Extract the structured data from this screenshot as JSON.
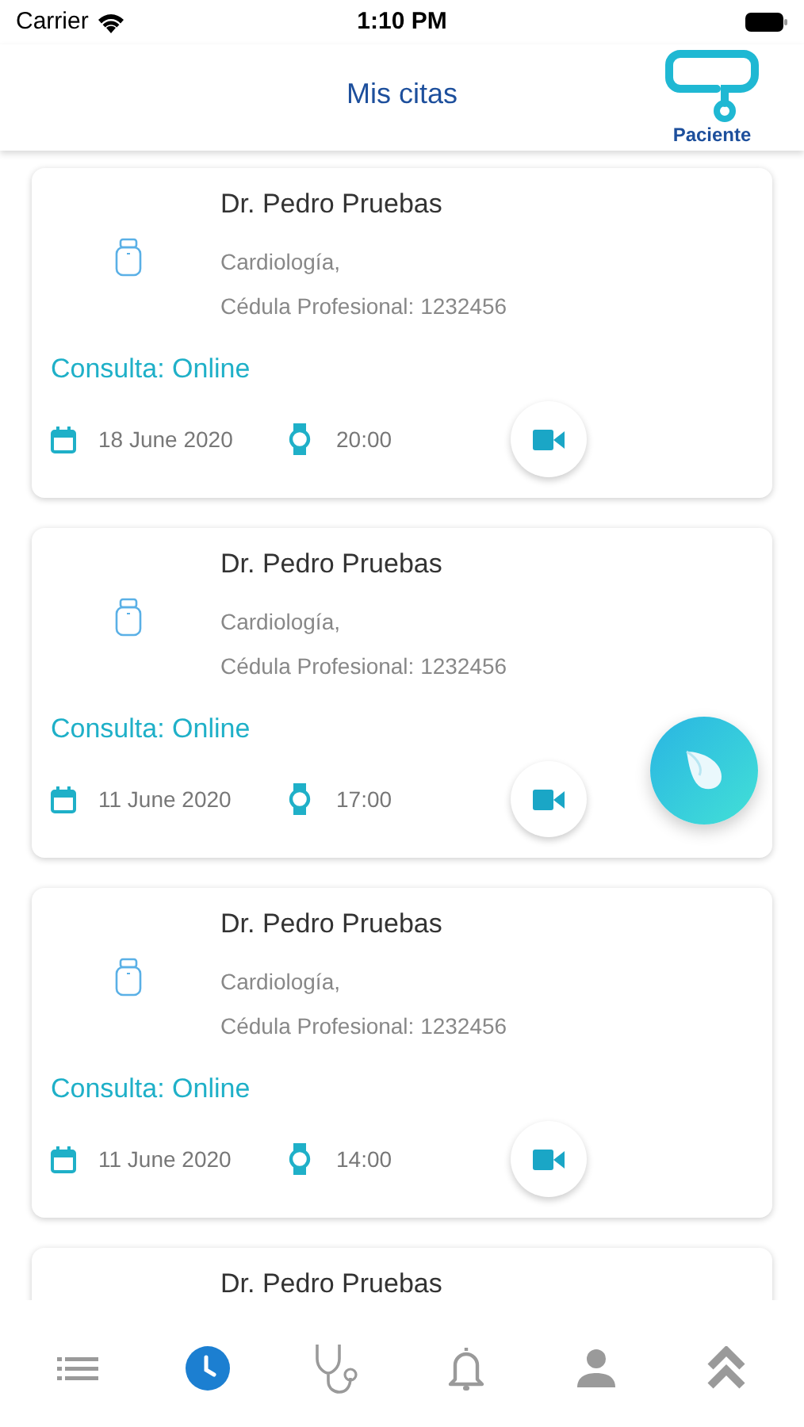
{
  "status_bar": {
    "carrier": "Carrier",
    "time": "1:10 PM"
  },
  "header": {
    "title": "Mis citas",
    "logo_label": "Paciente"
  },
  "appointments": [
    {
      "doctor": "Dr. Pedro Pruebas",
      "specialty": "Cardiología,",
      "license": "Cédula Profesional: 1232456",
      "consult": "Consulta: Online",
      "date": "18 June 2020",
      "time": "20:00"
    },
    {
      "doctor": "Dr. Pedro Pruebas",
      "specialty": "Cardiología,",
      "license": "Cédula Profesional: 1232456",
      "consult": "Consulta: Online",
      "date": "11 June 2020",
      "time": "17:00"
    },
    {
      "doctor": "Dr. Pedro Pruebas",
      "specialty": "Cardiología,",
      "license": "Cédula Profesional: 1232456",
      "consult": "Consulta: Online",
      "date": "11 June 2020",
      "time": "14:00"
    },
    {
      "doctor": "Dr. Pedro Pruebas"
    }
  ],
  "tab_bar": [
    {
      "kind": "list",
      "selected": false
    },
    {
      "kind": "clock",
      "selected": true
    },
    {
      "kind": "stethoscope",
      "selected": false
    },
    {
      "kind": "bell",
      "selected": false
    },
    {
      "kind": "person",
      "selected": false
    },
    {
      "kind": "chevrons",
      "selected": false
    }
  ]
}
